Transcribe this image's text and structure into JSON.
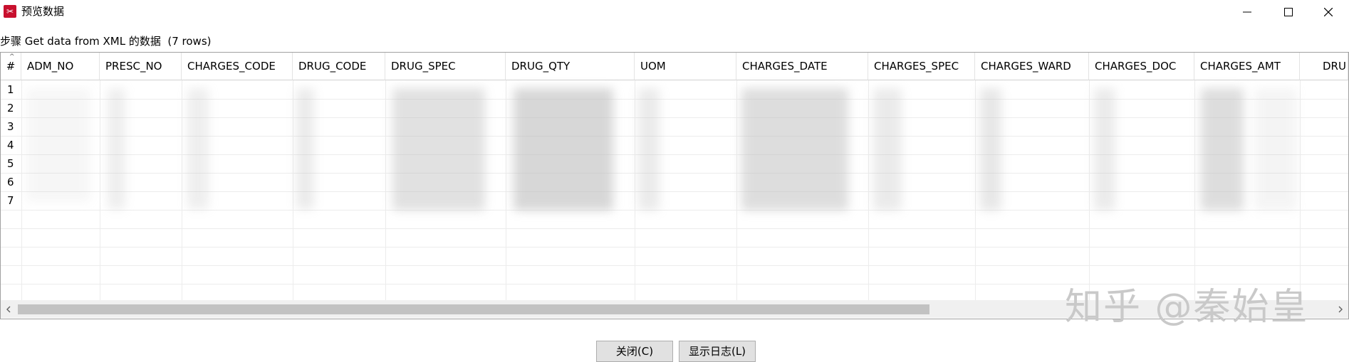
{
  "window": {
    "title": "预览数据",
    "icon": "kettle-app-icon"
  },
  "step_label": "步骤 Get data from XML 的数据  (7 rows)",
  "table": {
    "hash_header": "#",
    "columns": [
      "ADM_NO",
      "PRESC_NO",
      "CHARGES_CODE",
      "DRUG_CODE",
      "DRUG_SPEC",
      "DRUG_QTY",
      "UOM",
      "CHARGES_DATE",
      "CHARGES_SPEC",
      "CHARGES_WARD",
      "CHARGES_DOC",
      "CHARGES_AMT",
      "DRU"
    ],
    "row_numbers": [
      "1",
      "2",
      "3",
      "4",
      "5",
      "6",
      "7"
    ]
  },
  "buttons": {
    "close": "关闭(C)",
    "show_log": "显示日志(L)"
  },
  "watermark": "知乎 @秦始皇"
}
